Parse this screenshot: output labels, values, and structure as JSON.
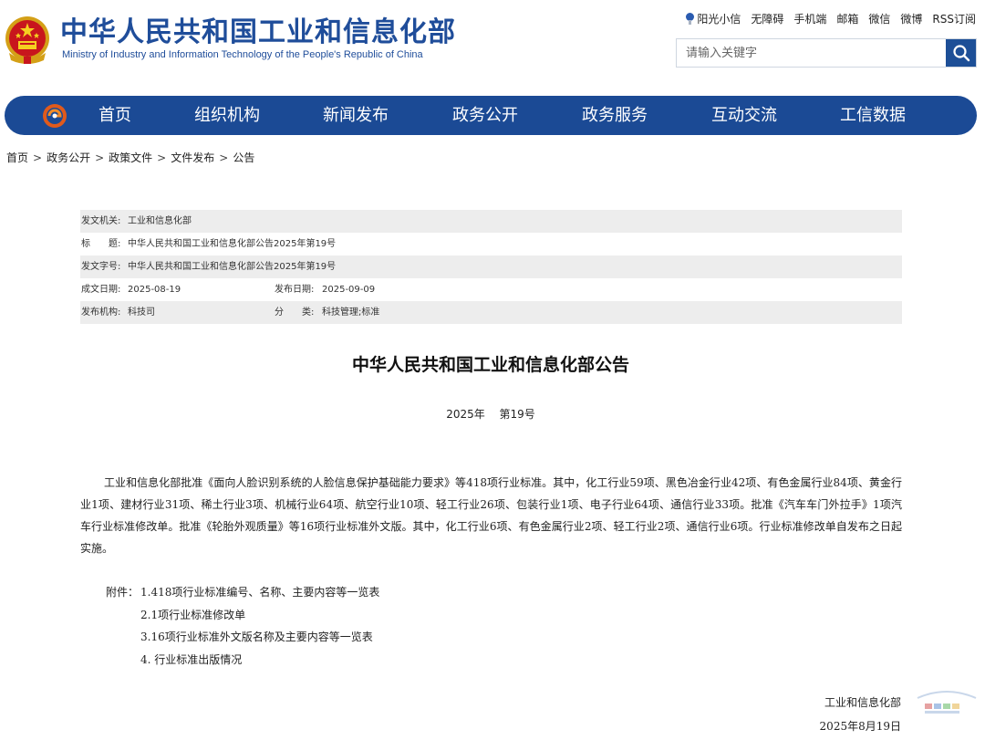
{
  "header": {
    "title_cn": "中华人民共和国工业和信息化部",
    "title_en": "Ministry of Industry and Information Technology of the People's Republic of China"
  },
  "toplinks": [
    "阳光小信",
    "无障碍",
    "手机端",
    "邮箱",
    "微信",
    "微博",
    "RSS订阅"
  ],
  "search": {
    "placeholder": "请输入关键字"
  },
  "nav": [
    "首页",
    "组织机构",
    "新闻发布",
    "政务公开",
    "政务服务",
    "互动交流",
    "工信数据"
  ],
  "breadcrumb": [
    "首页",
    "政务公开",
    "政策文件",
    "文件发布",
    "公告"
  ],
  "meta": {
    "issuer_label": "发文机关:",
    "issuer": "工业和信息化部",
    "subject_label": "标　　题:",
    "subject": "中华人民共和国工业和信息化部公告2025年第19号",
    "docno_label": "发文字号:",
    "docno": "中华人民共和国工业和信息化部公告2025年第19号",
    "created_label": "成文日期:",
    "created": "2025-08-19",
    "published_label": "发布日期:",
    "published": "2025-09-09",
    "org_label": "发布机构:",
    "org": "科技司",
    "category_label": "分　　类:",
    "category": "科技管理;标准"
  },
  "article": {
    "title": "中华人民共和国工业和信息化部公告",
    "number": "2025年　 第19号",
    "body": "工业和信息化部批准《面向人脸识别系统的人脸信息保护基础能力要求》等418项行业标准。其中，化工行业59项、黑色冶金行业42项、有色金属行业84项、黄金行业1项、建材行业31项、稀土行业3项、机械行业64项、航空行业10项、轻工行业26项、包装行业1项、电子行业64项、通信行业33项。批准《汽车车门外拉手》1项汽车行业标准修改单。批准《轮胎外观质量》等16项行业标准外文版。其中，化工行业6项、有色金属行业2项、轻工行业2项、通信行业6项。行业标准修改单自发布之日起实施。",
    "attachments_label": "附件：",
    "attachments": [
      "1.418项行业标准编号、名称、主要内容等一览表",
      "2.1项行业标准修改单",
      "3.16项行业标准外文版名称及主要内容等一览表",
      "4. 行业标准出版情况"
    ],
    "signature_org": "工业和信息化部",
    "signature_date": "2025年8月19日"
  },
  "colors": {
    "brand_blue": "#1b4a95",
    "title_blue": "#1f4d9a",
    "meta_row_shade": "#ededed"
  },
  "icons": {
    "emblem": "national-emblem-icon",
    "nav_logo": "ministry-logo-icon",
    "search": "search-icon",
    "sun": "sunshine-icon"
  }
}
